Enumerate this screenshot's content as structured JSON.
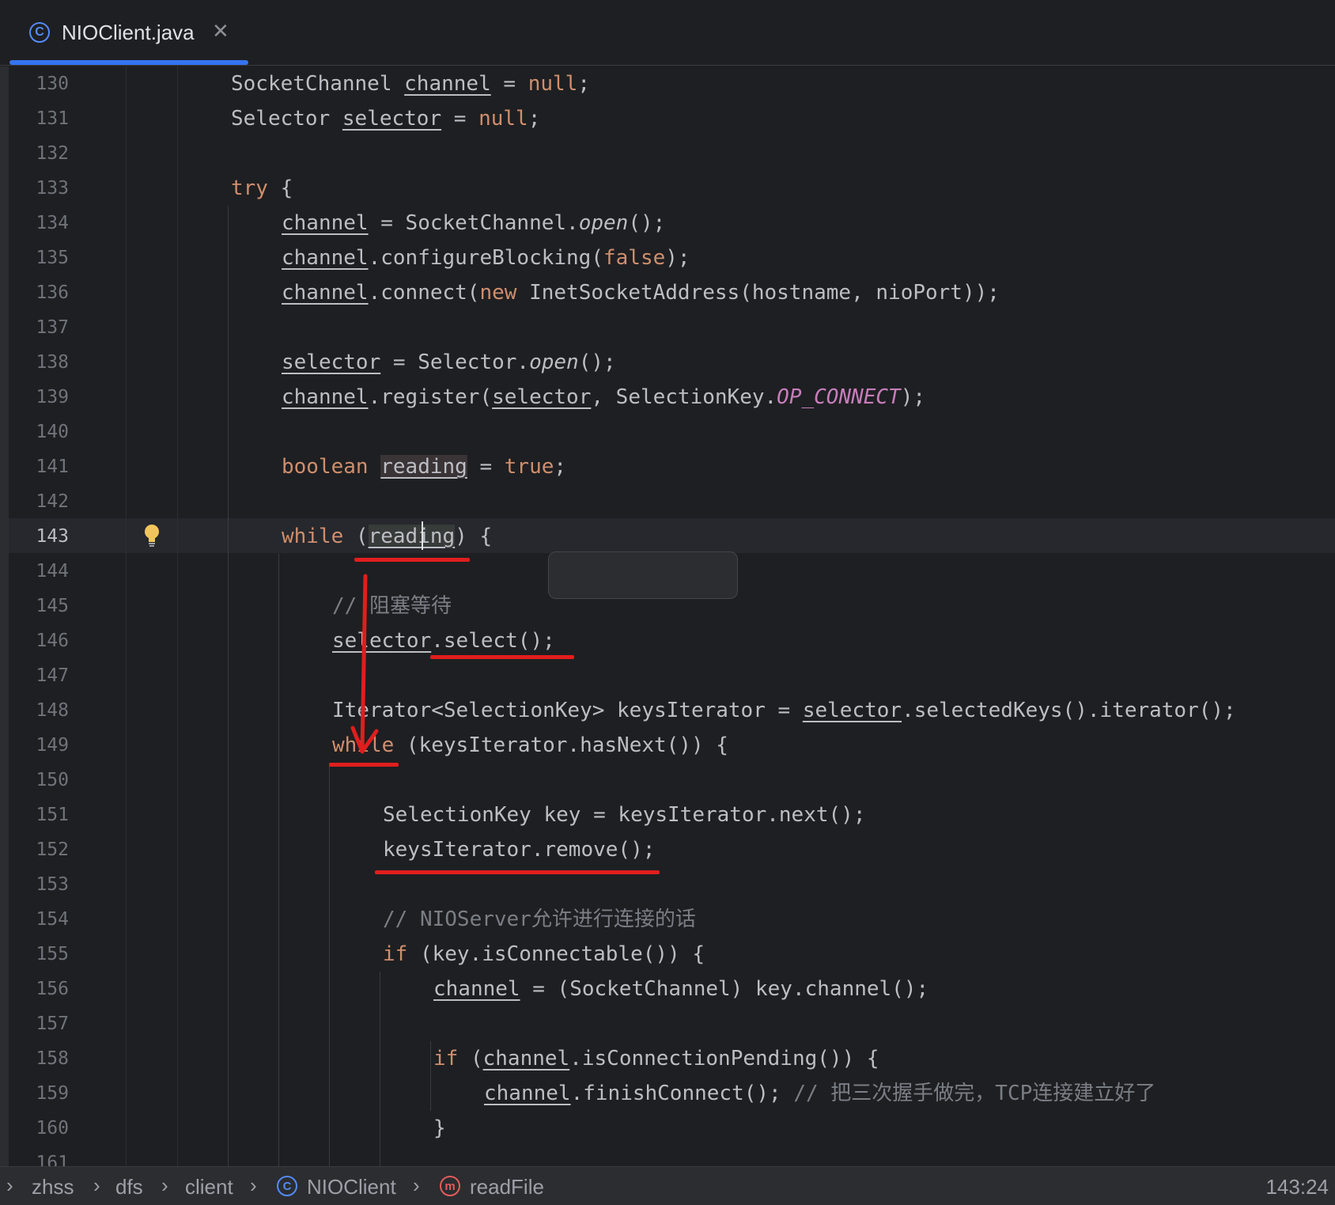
{
  "tab": {
    "label": "NIOClient.java",
    "icon": "class-icon",
    "close": "✕"
  },
  "code": [
    {
      "n": "130",
      "indent": 0,
      "segs": [
        {
          "t": "SocketChannel "
        },
        {
          "t": "channel",
          "c": "u"
        },
        {
          "t": " = "
        },
        {
          "t": "null",
          "c": "kw"
        },
        {
          "t": ";"
        }
      ]
    },
    {
      "n": "131",
      "indent": 0,
      "segs": [
        {
          "t": "Selector "
        },
        {
          "t": "selector",
          "c": "u"
        },
        {
          "t": " = "
        },
        {
          "t": "null",
          "c": "kw"
        },
        {
          "t": ";"
        }
      ]
    },
    {
      "n": "132",
      "indent": 0,
      "segs": []
    },
    {
      "n": "133",
      "indent": 0,
      "segs": [
        {
          "t": "try",
          "c": "kw"
        },
        {
          "t": " {"
        }
      ]
    },
    {
      "n": "134",
      "indent": 1,
      "segs": [
        {
          "t": "channel",
          "c": "u"
        },
        {
          "t": " = SocketChannel."
        },
        {
          "t": "open",
          "c": "it"
        },
        {
          "t": "();"
        }
      ]
    },
    {
      "n": "135",
      "indent": 1,
      "segs": [
        {
          "t": "channel",
          "c": "u"
        },
        {
          "t": ".configureBlocking("
        },
        {
          "t": "false",
          "c": "kw"
        },
        {
          "t": ");"
        }
      ]
    },
    {
      "n": "136",
      "indent": 1,
      "segs": [
        {
          "t": "channel",
          "c": "u"
        },
        {
          "t": ".connect("
        },
        {
          "t": "new",
          "c": "kw"
        },
        {
          "t": " InetSocketAddress(hostname, nioPort));"
        }
      ]
    },
    {
      "n": "137",
      "indent": 1,
      "segs": []
    },
    {
      "n": "138",
      "indent": 1,
      "segs": [
        {
          "t": "selector",
          "c": "u"
        },
        {
          "t": " = Selector."
        },
        {
          "t": "open",
          "c": "it"
        },
        {
          "t": "();"
        }
      ]
    },
    {
      "n": "139",
      "indent": 1,
      "segs": [
        {
          "t": "channel",
          "c": "u"
        },
        {
          "t": ".register("
        },
        {
          "t": "selector",
          "c": "u"
        },
        {
          "t": ", SelectionKey."
        },
        {
          "t": "OP_CONNECT",
          "c": "const"
        },
        {
          "t": ");"
        }
      ]
    },
    {
      "n": "140",
      "indent": 1,
      "segs": []
    },
    {
      "n": "141",
      "indent": 1,
      "segs": [
        {
          "t": "boolean",
          "c": "kw"
        },
        {
          "t": " "
        },
        {
          "t": "reading",
          "c": "u hl"
        },
        {
          "t": " = "
        },
        {
          "t": "true",
          "c": "kw"
        },
        {
          "t": ";"
        }
      ]
    },
    {
      "n": "142",
      "indent": 1,
      "segs": []
    },
    {
      "n": "143",
      "indent": 1,
      "segs": [
        {
          "t": "while",
          "c": "kw"
        },
        {
          "t": " ("
        },
        {
          "t": "reading",
          "c": "u hl2"
        },
        {
          "t": ") {"
        }
      ]
    },
    {
      "n": "144",
      "indent": 2,
      "segs": []
    },
    {
      "n": "145",
      "indent": 2,
      "segs": [
        {
          "t": "// 阻塞等待",
          "c": "cmt"
        }
      ]
    },
    {
      "n": "146",
      "indent": 2,
      "segs": [
        {
          "t": "selector",
          "c": "u"
        },
        {
          "t": ".select();"
        }
      ]
    },
    {
      "n": "147",
      "indent": 2,
      "segs": []
    },
    {
      "n": "148",
      "indent": 2,
      "segs": [
        {
          "t": "Iterator<SelectionKey> keysIterator = "
        },
        {
          "t": "selector",
          "c": "u"
        },
        {
          "t": ".selectedKeys().iterator();"
        }
      ]
    },
    {
      "n": "149",
      "indent": 2,
      "segs": [
        {
          "t": "while",
          "c": "kw"
        },
        {
          "t": " (keysIterator.hasNext()) {"
        }
      ]
    },
    {
      "n": "150",
      "indent": 3,
      "segs": []
    },
    {
      "n": "151",
      "indent": 3,
      "segs": [
        {
          "t": "SelectionKey key = keysIterator.next();"
        }
      ]
    },
    {
      "n": "152",
      "indent": 3,
      "segs": [
        {
          "t": "keysIterator.remove();"
        }
      ]
    },
    {
      "n": "153",
      "indent": 3,
      "segs": []
    },
    {
      "n": "154",
      "indent": 3,
      "segs": [
        {
          "t": "// NIOServer允许进行连接的话",
          "c": "cmt"
        }
      ]
    },
    {
      "n": "155",
      "indent": 3,
      "segs": [
        {
          "t": "if",
          "c": "kw"
        },
        {
          "t": " (key.isConnectable()) {"
        }
      ]
    },
    {
      "n": "156",
      "indent": 4,
      "segs": [
        {
          "t": "channel",
          "c": "u"
        },
        {
          "t": " = (SocketChannel) key.channel();"
        }
      ]
    },
    {
      "n": "157",
      "indent": 4,
      "segs": []
    },
    {
      "n": "158",
      "indent": 4,
      "segs": [
        {
          "t": "if",
          "c": "kw"
        },
        {
          "t": " ("
        },
        {
          "t": "channel",
          "c": "u"
        },
        {
          "t": ".isConnectionPending()) {"
        }
      ]
    },
    {
      "n": "159",
      "indent": 5,
      "segs": [
        {
          "t": "channel",
          "c": "u"
        },
        {
          "t": ".finishConnect(); "
        },
        {
          "t": "// 把三次握手做完，TCP连接建立好了",
          "c": "cmt"
        }
      ]
    },
    {
      "n": "160",
      "indent": 4,
      "segs": [
        {
          "t": "}"
        }
      ]
    },
    {
      "n": "161",
      "indent": 4,
      "segs": []
    }
  ],
  "current_line": "143",
  "breadcrumb": [
    {
      "label": "zhss"
    },
    {
      "label": "dfs"
    },
    {
      "label": "client"
    },
    {
      "label": "NIOClient",
      "icon": "class-icon"
    },
    {
      "label": "readFile",
      "icon": "method-icon"
    }
  ],
  "cursor_position": "143:24"
}
